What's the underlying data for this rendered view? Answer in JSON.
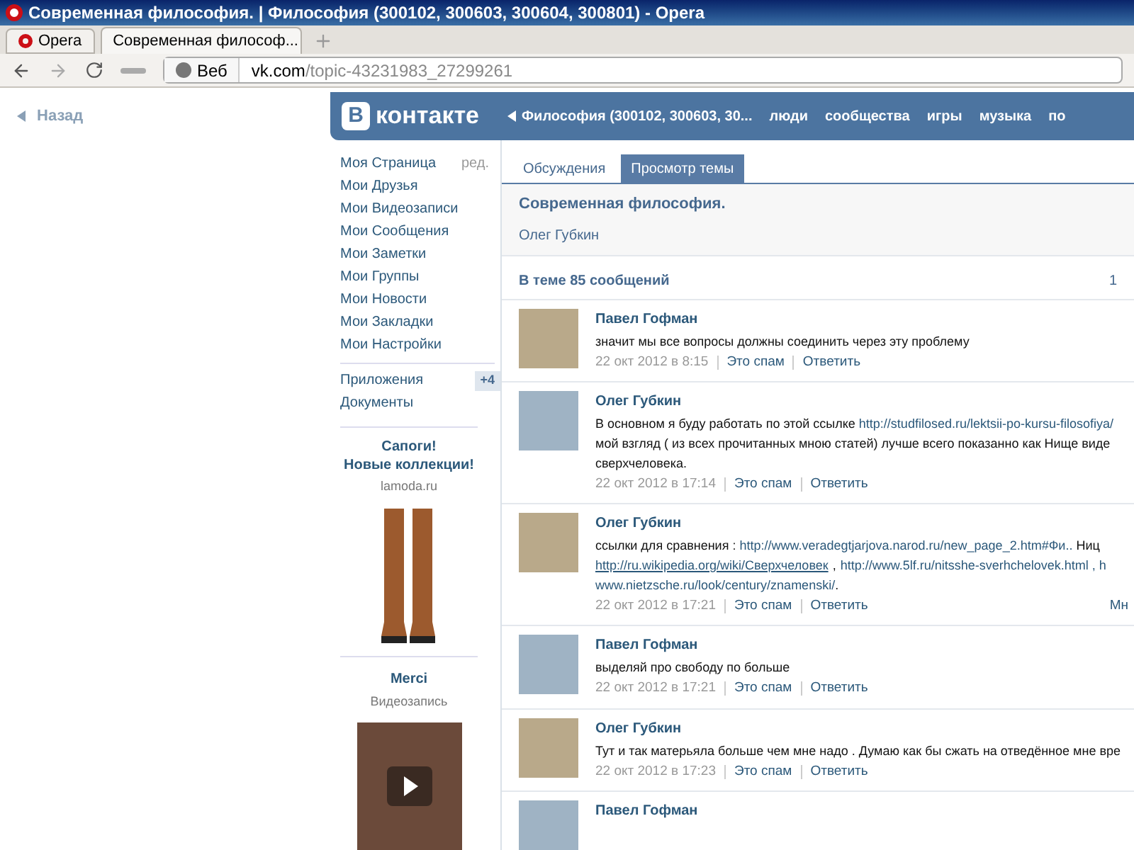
{
  "window": {
    "title": "Современная философия. | Философия (300102, 300603, 300604, 300801) - Opera"
  },
  "browser": {
    "menu_button": "Opera",
    "tabs": [
      {
        "label": "Современная философ...",
        "selected": true
      }
    ],
    "web_label": "Веб",
    "url_host": "vk.com",
    "url_path": "/topic-43231983_27299261"
  },
  "back_link": "Назад",
  "header": {
    "logo_letter": "В",
    "logo_text": "контакте",
    "nav": [
      {
        "label": "Философия (300102, 300603, 30...",
        "kind": "back"
      },
      {
        "label": "люди",
        "kind": "link"
      },
      {
        "label": "сообщества",
        "kind": "link"
      },
      {
        "label": "игры",
        "kind": "link"
      },
      {
        "label": "музыка",
        "kind": "link"
      },
      {
        "label": "по",
        "kind": "link"
      }
    ]
  },
  "sidebar": {
    "items": [
      {
        "label": "Моя Страница",
        "extra": "ред."
      },
      {
        "label": "Мои Друзья"
      },
      {
        "label": "Мои Видеозаписи"
      },
      {
        "label": "Мои Сообщения"
      },
      {
        "label": "Мои Заметки"
      },
      {
        "label": "Мои Группы"
      },
      {
        "label": "Мои Новости"
      },
      {
        "label": "Мои Закладки"
      },
      {
        "label": "Мои Настройки"
      }
    ],
    "extra_items": [
      {
        "label": "Приложения",
        "badge": "+4"
      },
      {
        "label": "Документы"
      }
    ],
    "ad": {
      "title": "Сапоги!\nНовые коллекции!",
      "domain": "lamoda.ru"
    },
    "video": {
      "title": "Merci",
      "subtitle": "Видеозапись"
    }
  },
  "tabs": [
    {
      "label": "Обсуждения",
      "selected": false
    },
    {
      "label": "Просмотр темы",
      "selected": true
    }
  ],
  "topic": {
    "title": "Современная философия.",
    "author": "Олег Губкин",
    "count": "В теме 85 сообщений",
    "page": "1"
  },
  "posts": [
    {
      "author": "Павел Гофман",
      "lines": [
        [
          {
            "text": "значит мы все вопросы должны соединить через эту проблему",
            "kind": "text"
          }
        ]
      ],
      "date": "22 окт 2012 в 8:15",
      "spam": "Это спам",
      "reply": "Ответить"
    },
    {
      "author": "Олег Губкин",
      "lines": [
        [
          {
            "text": "В основном я буду работать по этой ссылке ",
            "kind": "text"
          },
          {
            "text": "http://studfilosed.ru/lektsii-po-kursu-filosofiya/",
            "kind": "link"
          }
        ],
        [
          {
            "text": "мой взгляд ( из всех прочитанных мною статей) лучше всего показанно как Нище виде",
            "kind": "text"
          }
        ],
        [
          {
            "text": "сверхчеловека.",
            "kind": "text"
          }
        ]
      ],
      "date": "22 окт 2012 в 17:14",
      "spam": "Это спам",
      "reply": "Ответить"
    },
    {
      "author": "Олег Губкин",
      "lines": [
        [
          {
            "text": "ссылки для сравнения : ",
            "kind": "text"
          },
          {
            "text": "http://www.veradegtjarjova.narod.ru/new_page_2.htm#Фи..",
            "kind": "link"
          },
          {
            "text": " Ниц",
            "kind": "text"
          }
        ],
        [
          {
            "text": "http://ru.wikipedia.org/wiki/Сверхчеловек",
            "kind": "underlined"
          },
          {
            "text": ",",
            "kind": "separator"
          },
          {
            "text": "http://www.5lf.ru/nitsshe-sverhchelovek.html",
            "kind": "link"
          },
          {
            "text": " , h",
            "kind": "link"
          }
        ],
        [
          {
            "text": "www.nietzsche.ru/look/century/znamenski/",
            "kind": "link"
          },
          {
            "text": ".",
            "kind": "text"
          }
        ]
      ],
      "date": "22 окт 2012 в 17:21",
      "spam": "Это спам",
      "reply": "Ответить",
      "more": "Мн"
    },
    {
      "author": "Павел Гофман",
      "lines": [
        [
          {
            "text": "выделяй про свободу по больше",
            "kind": "text"
          }
        ]
      ],
      "date": "22 окт 2012 в 17:21",
      "spam": "Это спам",
      "reply": "Ответить"
    },
    {
      "author": "Олег Губкин",
      "lines": [
        [
          {
            "text": "Тут и так матерьяла больше чем мне надо . Думаю как бы сжать на отведённое мне вре",
            "kind": "text"
          }
        ]
      ],
      "date": "22 окт 2012 в 17:23",
      "spam": "Это спам",
      "reply": "Ответить"
    },
    {
      "author": "Павел Гофман"
    }
  ]
}
